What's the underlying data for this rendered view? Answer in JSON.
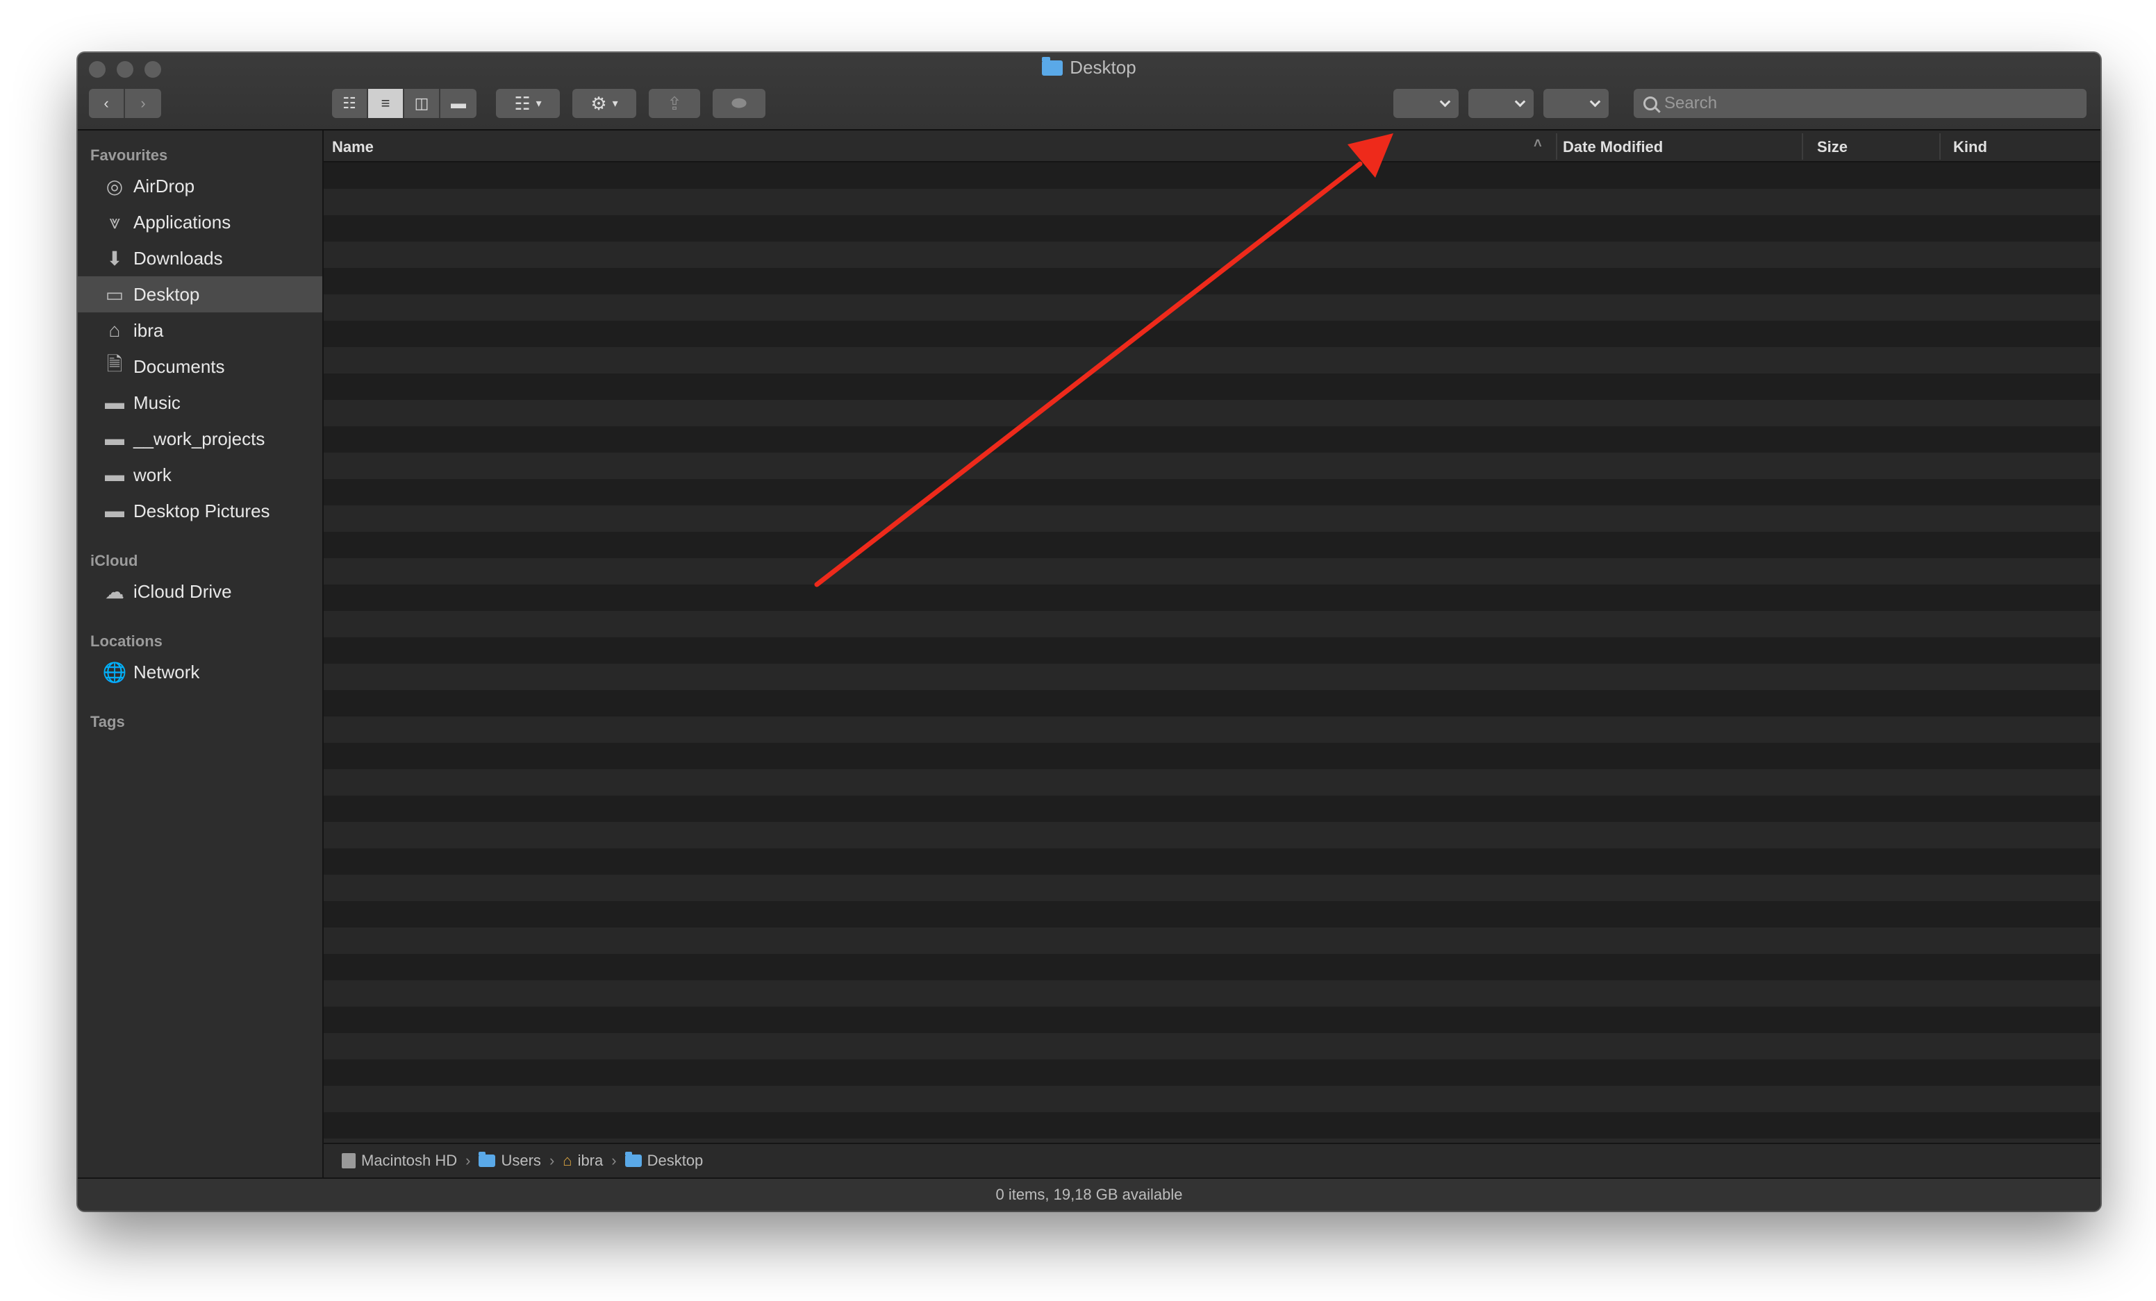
{
  "window": {
    "title": "Desktop"
  },
  "toolbar": {
    "back_icon": "chevron-left-icon",
    "forward_icon": "chevron-right-icon",
    "views": [
      "icon-view",
      "list-view",
      "column-view",
      "gallery-view"
    ],
    "active_view": "list-view",
    "search_placeholder": "Search"
  },
  "sidebar": {
    "sections": [
      {
        "title": "Favourites",
        "items": [
          {
            "label": "AirDrop",
            "icon": "airdrop-icon"
          },
          {
            "label": "Applications",
            "icon": "applications-icon"
          },
          {
            "label": "Downloads",
            "icon": "downloads-icon"
          },
          {
            "label": "Desktop",
            "icon": "desktop-icon",
            "selected": true
          },
          {
            "label": "ibra",
            "icon": "home-icon"
          },
          {
            "label": "Documents",
            "icon": "documents-icon"
          },
          {
            "label": "Music",
            "icon": "folder-icon"
          },
          {
            "label": "__work_projects",
            "icon": "folder-icon"
          },
          {
            "label": "work",
            "icon": "folder-icon"
          },
          {
            "label": "Desktop Pictures",
            "icon": "folder-icon"
          }
        ]
      },
      {
        "title": "iCloud",
        "items": [
          {
            "label": "iCloud Drive",
            "icon": "cloud-icon"
          }
        ]
      },
      {
        "title": "Locations",
        "items": [
          {
            "label": "Network",
            "icon": "network-icon"
          }
        ]
      },
      {
        "title": "Tags",
        "items": []
      }
    ]
  },
  "columns": {
    "name": "Name",
    "date_modified": "Date Modified",
    "size": "Size",
    "kind": "Kind"
  },
  "pathbar": [
    {
      "label": "Macintosh HD",
      "icon": "disk-icon"
    },
    {
      "label": "Users",
      "icon": "folder-icon"
    },
    {
      "label": "ibra",
      "icon": "home-icon"
    },
    {
      "label": "Desktop",
      "icon": "folder-icon"
    }
  ],
  "status": "0 items, 19,18 GB available",
  "annotation": {
    "color": "#ee2a1b"
  }
}
